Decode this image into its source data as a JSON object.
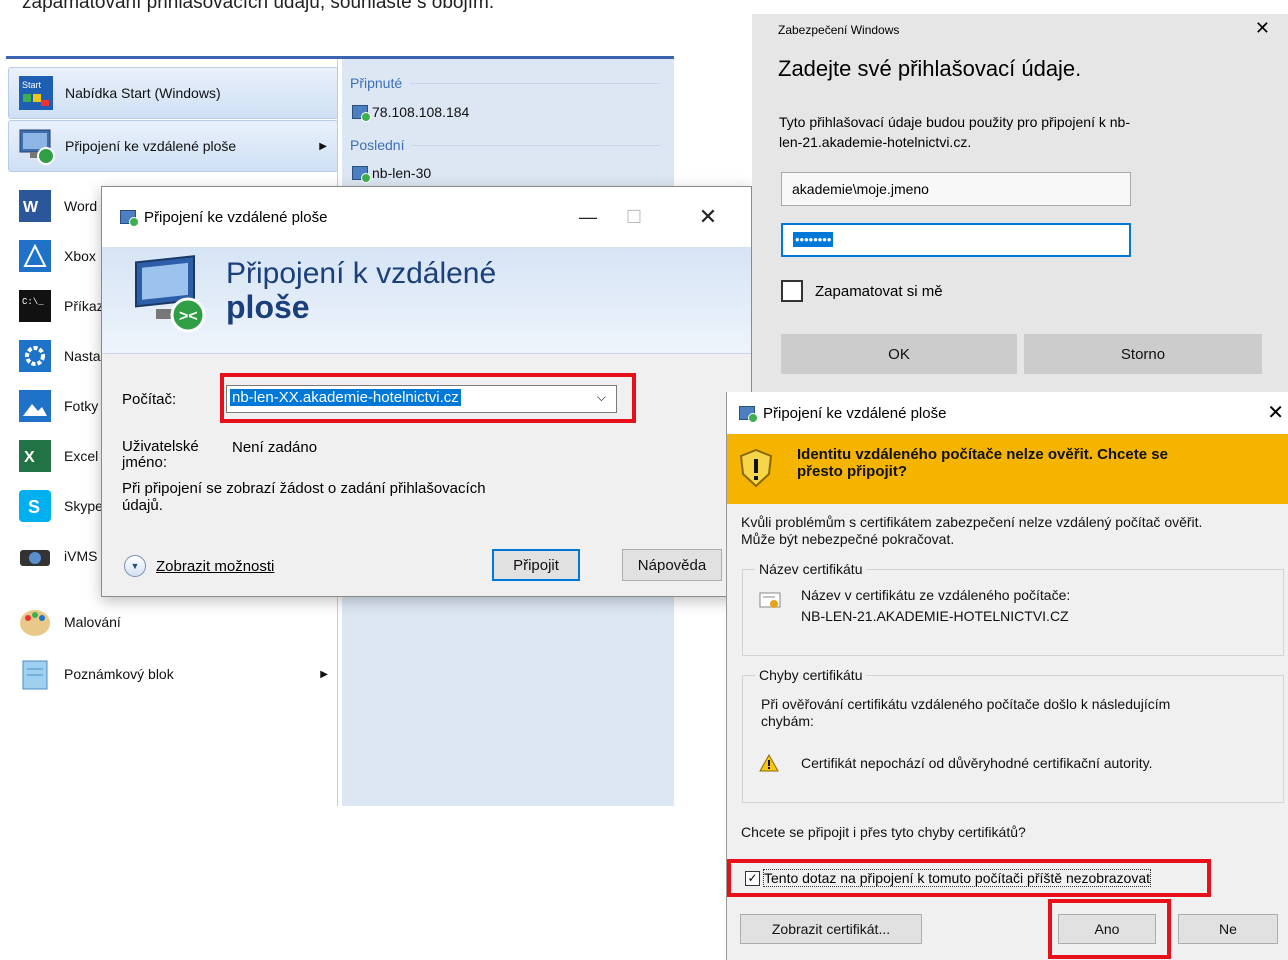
{
  "intro_text": "zapamatování přihlašovacích údajů, souhlaste s obojím.",
  "start_menu": {
    "items": [
      {
        "label": "Nabídka Start (Windows)"
      },
      {
        "label": "Připojení ke vzdálené ploše"
      },
      {
        "label": "Word"
      },
      {
        "label": "Xbox"
      },
      {
        "label": "Příkaz"
      },
      {
        "label": "Nasta"
      },
      {
        "label": "Fotky"
      },
      {
        "label": "Excel"
      },
      {
        "label": "Skype"
      },
      {
        "label": "iVMS"
      },
      {
        "label": "Malování"
      },
      {
        "label": "Poznámkový blok"
      }
    ],
    "pinned_header": "Připnuté",
    "pinned_item": "78.108.108.184",
    "recent_header": "Poslední",
    "recent_item": "nb-len-30"
  },
  "rdp_dialog": {
    "title": "Připojení ke vzdálené ploše",
    "banner_line1": "Připojení k vzdálené",
    "banner_line2": "ploše",
    "computer_label": "Počítač:",
    "computer_value": "nb-len-XX.akademie-hotelnictvi.cz",
    "username_label_1": "Uživatelské",
    "username_label_2": "jméno:",
    "username_value": "Není zadáno",
    "info_line1": "Při připojení se zobrazí žádost o zadání přihlašovacích",
    "info_line2": "údajů.",
    "options_label": "Zobrazit možnosti",
    "connect_button": "Připojit",
    "help_button": "Nápověda"
  },
  "win_security": {
    "title": "Zabezpečení Windows",
    "heading": "Zadejte své přihlašovací údaje.",
    "desc_line1": "Tyto přihlašovací údaje budou použity pro připojení k nb-",
    "desc_line2": "len-21.akademie-hotelnictvi.cz.",
    "username_value": "akademie\\moje.jmeno",
    "password_mask": "••••••••",
    "remember_label": "Zapamatovat si mě",
    "ok_button": "OK",
    "cancel_button": "Storno"
  },
  "cert_dialog": {
    "title": "Připojení ke vzdálené ploše",
    "warning_line1": "Identitu vzdáleného počítače nelze ověřit. Chcete se",
    "warning_line2": "přesto připojit?",
    "body_line1": "Kvůli problémům s certifikátem zabezpečení nelze vzdálený počítač ověřit.",
    "body_line2": "Může být nebezpečné pokračovat.",
    "cert_name_group": "Název certifikátu",
    "cert_name_label": "Název v certifikátu ze vzdáleného počítače:",
    "cert_name_value": "NB-LEN-21.AKADEMIE-HOTELNICTVI.CZ",
    "cert_errors_group": "Chyby certifikátu",
    "cert_errors_line1": "Při ověřování certifikátu vzdáleného počítače došlo k následujícím",
    "cert_errors_line2": "chybám:",
    "cert_error_item": "Certifikát nepochází od důvěryhodné certifikační autority.",
    "question": "Chcete se připojit i přes tyto chyby certifikátů?",
    "dont_ask_label": "Tento dotaz na připojení k tomuto počítači příště nezobrazovat",
    "view_cert_button": "Zobrazit certifikát...",
    "yes_button": "Ano",
    "no_button": "Ne"
  },
  "colors": {
    "highlight_red": "#e8101a",
    "warning_band": "#f4b400",
    "accent_blue": "#3a6fb8"
  }
}
